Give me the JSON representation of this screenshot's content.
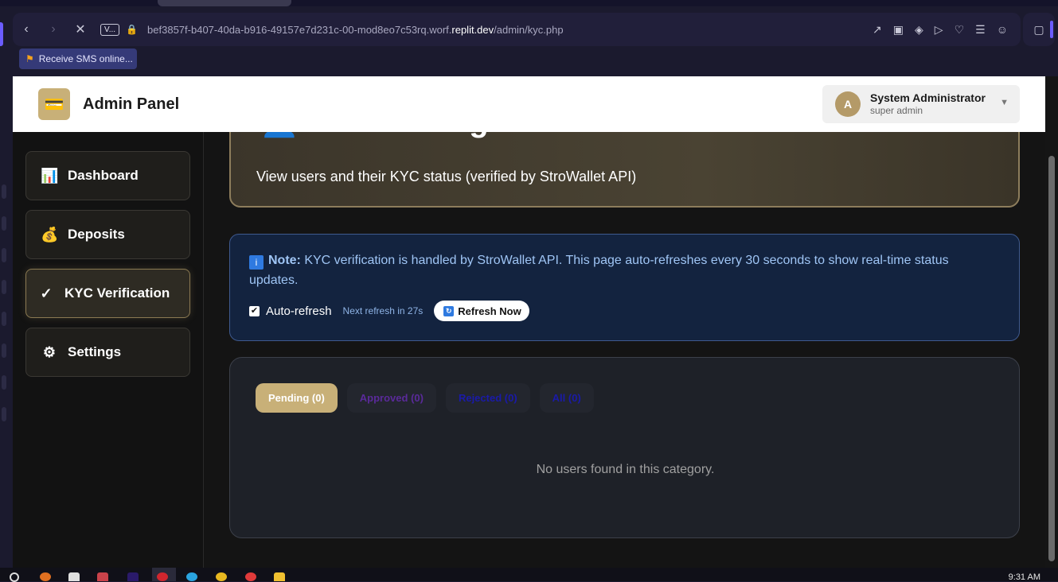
{
  "browser": {
    "site_badge": "V...",
    "url_prefix": "bef3857f-b407-40da-b916-49157e7d231c-00-mod8eo7c53rq.worf.",
    "url_domain": "replit.dev",
    "url_path": "/admin/kyc.php",
    "bookmark_label": "Receive SMS online..."
  },
  "header": {
    "brand": "Admin Panel",
    "user_initial": "A",
    "user_name": "System Administrator",
    "user_role": "super admin"
  },
  "sidebar": {
    "items": [
      {
        "label": "Dashboard",
        "icon": "chart-icon",
        "glyph": "📊"
      },
      {
        "label": "Deposits",
        "icon": "money-bag-icon",
        "glyph": "💰"
      },
      {
        "label": "KYC Verification",
        "icon": "check-icon",
        "glyph": "✓"
      },
      {
        "label": "Settings",
        "icon": "gear-icon",
        "glyph": "⚙"
      }
    ]
  },
  "hero": {
    "title": "👤 User Management",
    "subtitle": "View users and their KYC status (verified by StroWallet API)"
  },
  "note": {
    "icon_glyph": "i",
    "label": "Note:",
    "text": " KYC verification is handled by StroWallet API. This page auto-refreshes every 30 seconds to show real-time status updates.",
    "auto_refresh_label": "Auto-refresh",
    "auto_refresh_checked": true,
    "next_refresh": "Next refresh in 27s",
    "refresh_button": "Refresh Now"
  },
  "tabs": [
    {
      "label": "Pending (0)",
      "active": true
    },
    {
      "label": "Approved (0)",
      "active": false
    },
    {
      "label": "Rejected (0)",
      "active": false
    },
    {
      "label": "All (0)",
      "active": false
    }
  ],
  "empty_message": "No users found in this category.",
  "taskbar": {
    "time": "9:31 AM"
  },
  "colors": {
    "accent_gold": "#c8b078",
    "note_blue": "#9fc5f5",
    "note_bg": "#13233f"
  }
}
